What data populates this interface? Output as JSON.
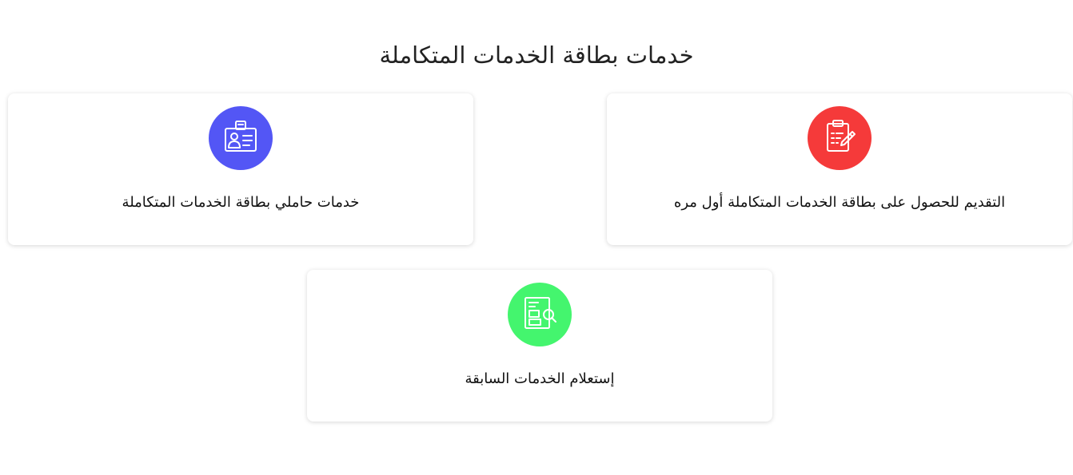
{
  "page": {
    "title": "خدمات بطاقة الخدمات المتكاملة"
  },
  "cards": [
    {
      "label": "التقديم للحصول على بطاقة الخدمات المتكاملة أول مره",
      "icon": "clipboard-edit-icon",
      "color": "#f53a3a"
    },
    {
      "label": "خدمات حاملي بطاقة الخدمات المتكاملة",
      "icon": "id-badge-icon",
      "color": "#5356f5"
    },
    {
      "label": "إستعلام الخدمات السابقة",
      "icon": "document-search-icon",
      "color": "#44f56e"
    }
  ]
}
